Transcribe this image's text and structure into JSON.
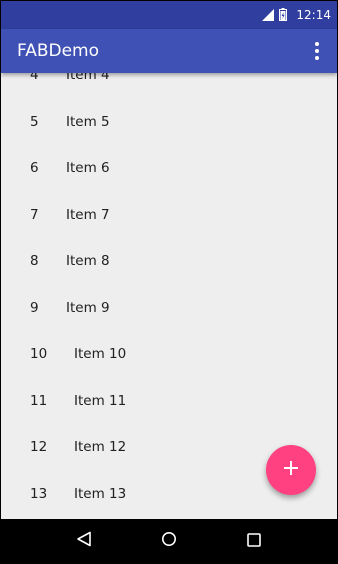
{
  "status_bar": {
    "time": "12:14",
    "icons": [
      "signal-icon",
      "battery-icon"
    ]
  },
  "app_bar": {
    "title": "FABDemo",
    "menu_icon": "overflow-menu-icon"
  },
  "list": {
    "items": [
      {
        "num": "4",
        "label": "Item 4"
      },
      {
        "num": "5",
        "label": "Item 5"
      },
      {
        "num": "6",
        "label": "Item 6"
      },
      {
        "num": "7",
        "label": "Item 7"
      },
      {
        "num": "8",
        "label": "Item 8"
      },
      {
        "num": "9",
        "label": "Item 9"
      },
      {
        "num": "10",
        "label": "Item 10"
      },
      {
        "num": "11",
        "label": "Item 11"
      },
      {
        "num": "12",
        "label": "Item 12"
      },
      {
        "num": "13",
        "label": "Item 13"
      }
    ]
  },
  "fab": {
    "icon": "plus-icon",
    "color": "#ff4081"
  },
  "nav_bar": {
    "buttons": [
      "back-icon",
      "home-icon",
      "recents-icon"
    ]
  },
  "colors": {
    "primary": "#3f51b5",
    "primary_dark": "#303f9f",
    "accent": "#ff4081",
    "background": "#eeeeee"
  }
}
